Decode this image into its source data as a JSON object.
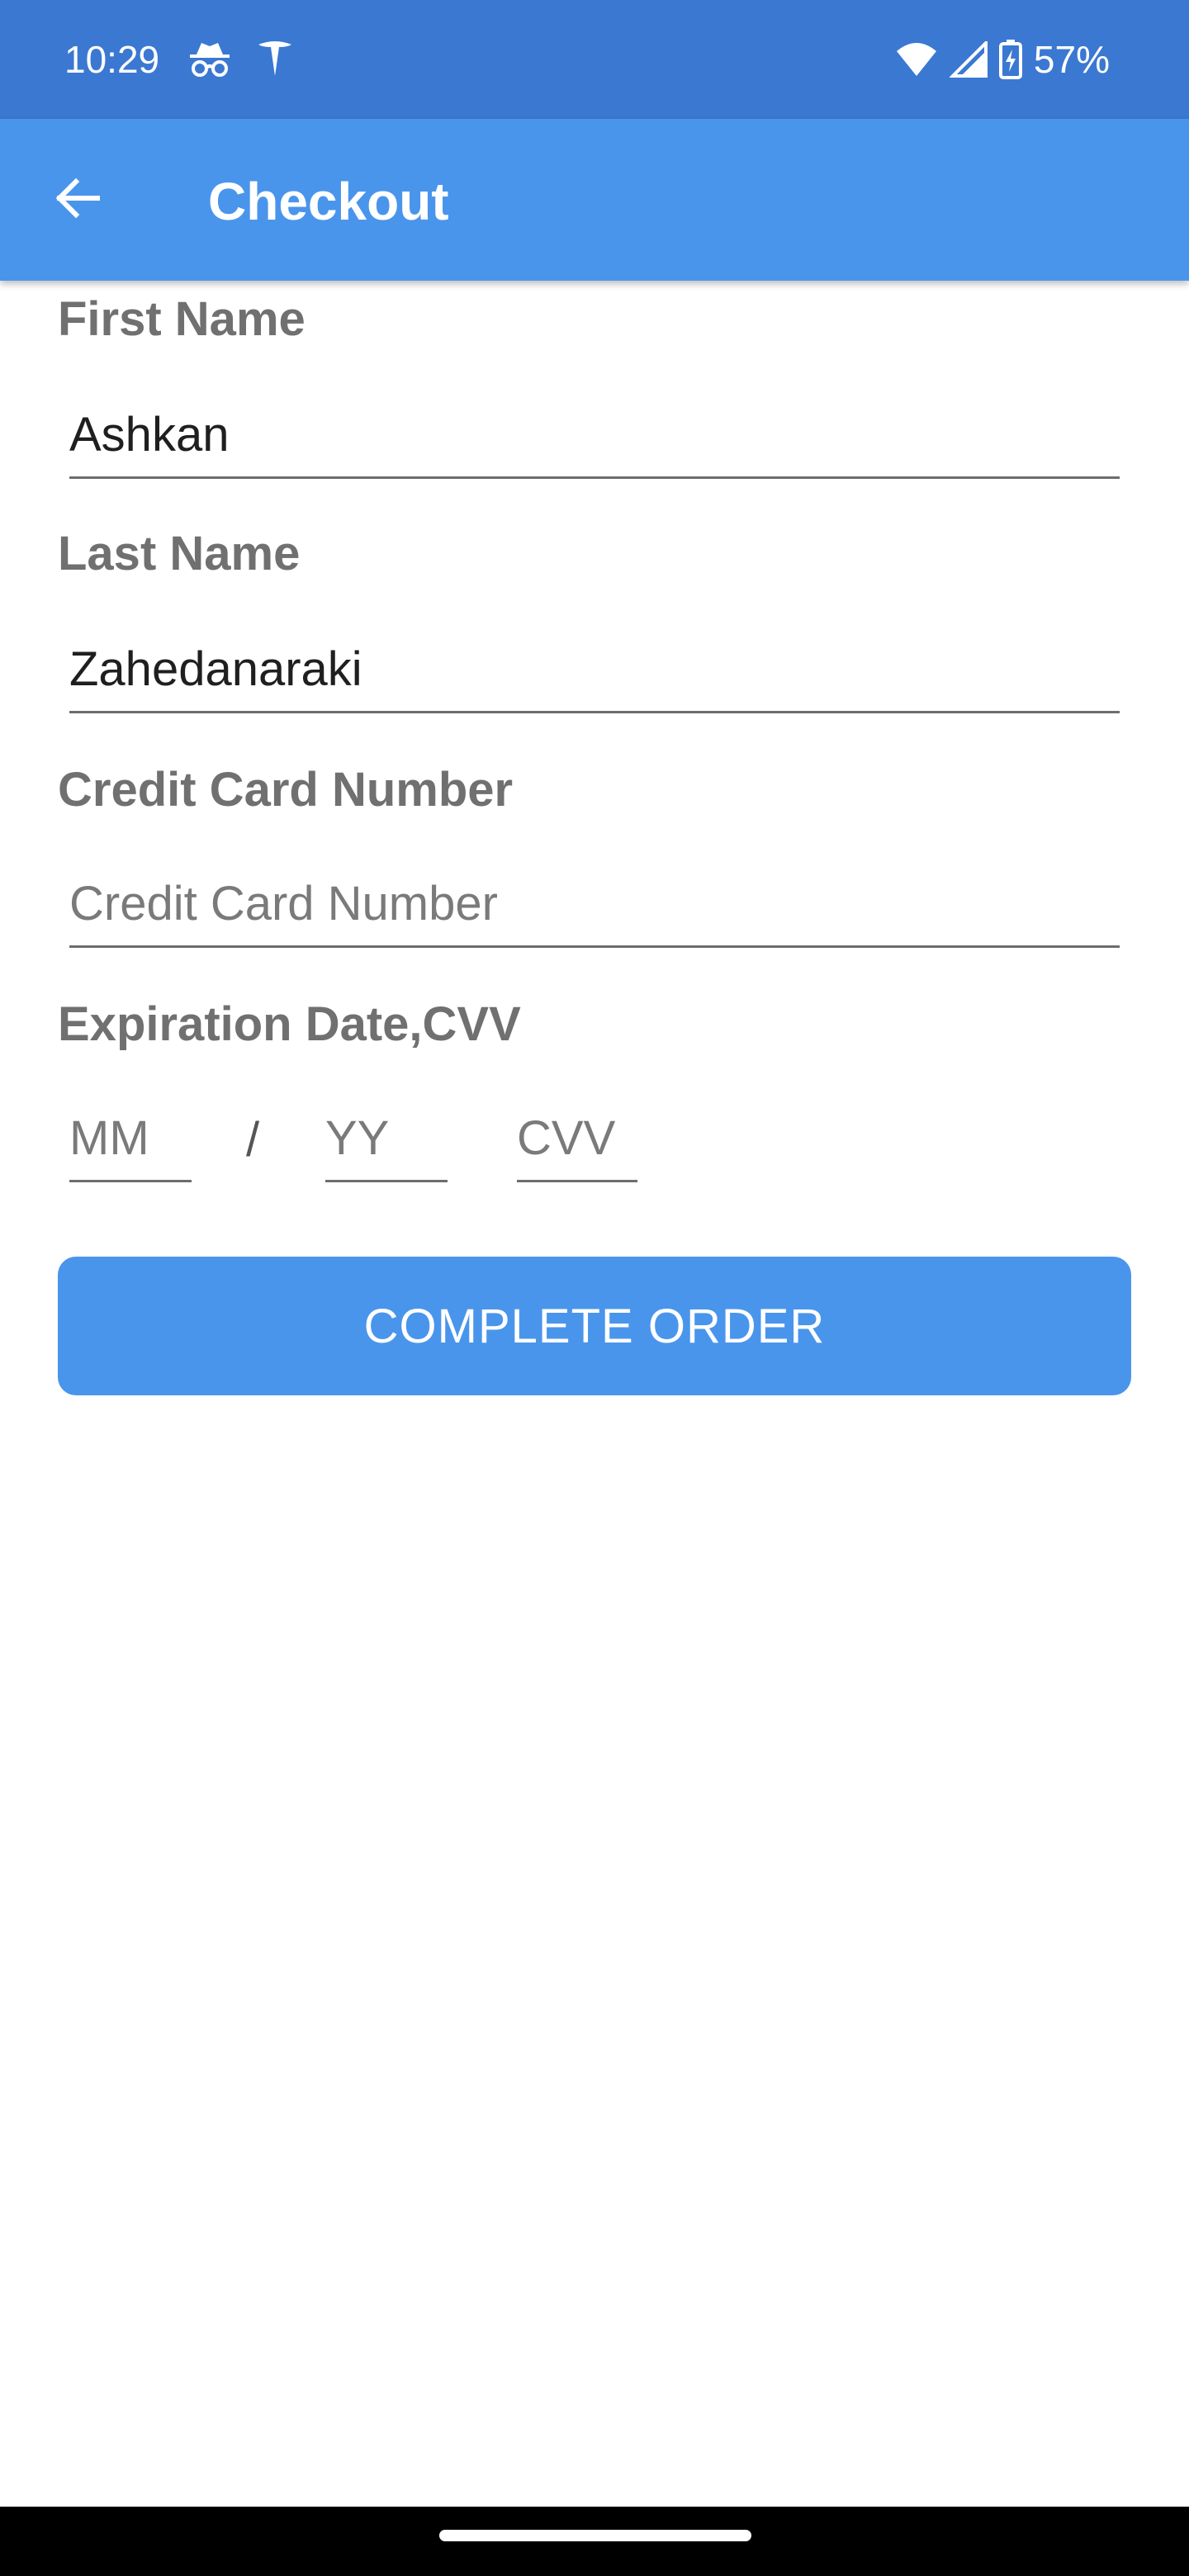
{
  "status_bar": {
    "time": "10:29",
    "battery": "57%",
    "icons": [
      "incognito-icon",
      "tesla-icon",
      "wifi-icon",
      "signal-icon",
      "battery-charging-icon"
    ],
    "background": "#3b78d2"
  },
  "app_bar": {
    "title": "Checkout",
    "back_icon": "arrow-back-icon",
    "background": "#4a95ec"
  },
  "form": {
    "first_name": {
      "label": "First Name",
      "value": "Ashkan",
      "placeholder": ""
    },
    "last_name": {
      "label": "Last Name",
      "value": "Zahedanaraki",
      "placeholder": ""
    },
    "card_number": {
      "label": "Credit Card Number",
      "value": "",
      "placeholder": "Credit Card Number"
    },
    "expiration": {
      "label": "Expiration Date,CVV",
      "month_placeholder": "MM",
      "separator": "/",
      "year_placeholder": "YY",
      "cvv_placeholder": "CVV"
    }
  },
  "actions": {
    "complete_order_label": "COMPLETE ORDER",
    "button_color": "#4a95ec"
  }
}
